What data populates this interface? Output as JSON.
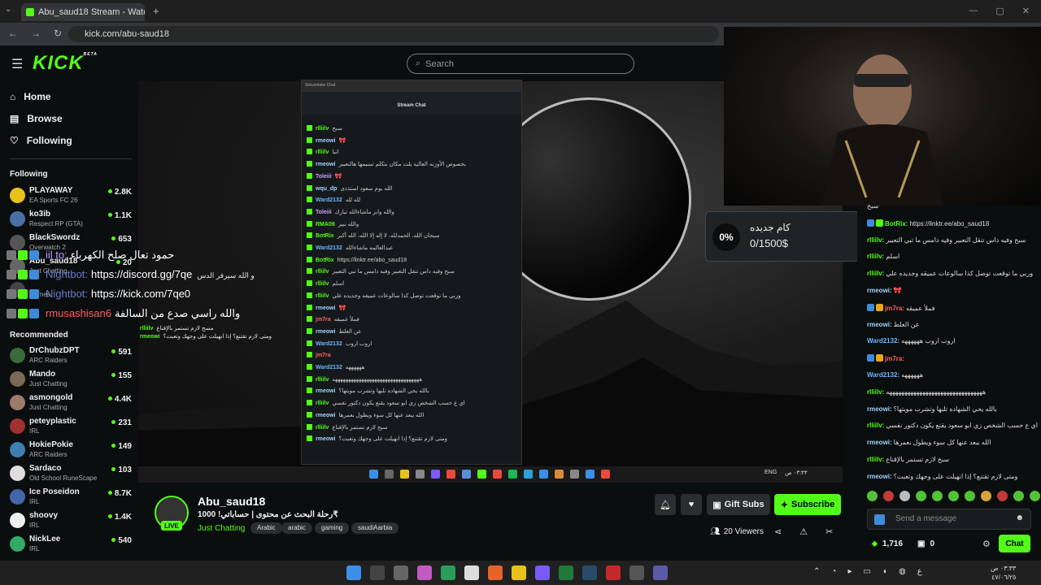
{
  "browser": {
    "tab_title": "Abu_saud18 Stream - Watch Li",
    "tab_close": "✕",
    "new_tab": "+",
    "tab_menu": "⌄",
    "url": "kick.com/abu-saud18",
    "back": "←",
    "forward": "→",
    "reload": "↻",
    "min": "—",
    "max": "▢",
    "close": "✕"
  },
  "header": {
    "logo": "KICK",
    "beta": "BETA",
    "search_placeholder": "Search"
  },
  "sidebar": {
    "nav": [
      {
        "label": "Home",
        "icon": "⌂"
      },
      {
        "label": "Browse",
        "icon": "▤"
      },
      {
        "label": "Following",
        "icon": "♡"
      }
    ],
    "following_title": "Following",
    "following": [
      {
        "name": "PLAYAWAY",
        "category": "EA Sports FC 26",
        "viewers": "2.8K",
        "color": "#e8c21a"
      },
      {
        "name": "ko3ib",
        "category": "Respect RP (GTA)",
        "viewers": "1.1K",
        "color": "#4a6fa5"
      },
      {
        "name": "BlackSwordz",
        "category": "Overwatch 2",
        "viewers": "653",
        "color": "#555"
      },
      {
        "name": "Abu_saud18",
        "category": "Just Chatting",
        "viewers": "20",
        "color": "#666"
      },
      {
        "name": "",
        "category": "Games",
        "viewers": "",
        "color": "#444"
      }
    ],
    "recommended_title": "Recommended",
    "recommended": [
      {
        "name": "DrChubzDPT",
        "category": "ARC Raiders",
        "viewers": "591",
        "color": "#3b6b3b"
      },
      {
        "name": "Mando",
        "category": "Just Chatting",
        "viewers": "155",
        "color": "#7a6a55"
      },
      {
        "name": "asmongold",
        "category": "Just Chatting",
        "viewers": "4.4K",
        "color": "#9a7b6a"
      },
      {
        "name": "peteyplastic",
        "category": "IRL",
        "viewers": "231",
        "color": "#a03030"
      },
      {
        "name": "HokiePokie",
        "category": "ARC Raiders",
        "viewers": "149",
        "color": "#3d7fb0"
      },
      {
        "name": "Sardaco",
        "category": "Old School RuneScape",
        "viewers": "103",
        "color": "#ddd"
      },
      {
        "name": "Ice Poseidon",
        "category": "IRL",
        "viewers": "8.7K",
        "color": "#4466aa"
      },
      {
        "name": "shoovy",
        "category": "IRL",
        "viewers": "1.4K",
        "color": "#eee"
      },
      {
        "name": "NickLee",
        "category": "IRL",
        "viewers": "540",
        "color": "#3a6"
      }
    ]
  },
  "video_overlay": {
    "lines": [
      {
        "user": "iil to:",
        "text": "حمود تعال صلح الكهرباء",
        "color": "#b89cff"
      },
      {
        "user": "Nightbot:",
        "text": "https://discord.gg/7qe",
        "suffix": "و الله سيرفر الدس",
        "color": "#6a78c9"
      },
      {
        "user": "Nightbot:",
        "text": "https://kick.com/7qe0",
        "suffix": "",
        "color": "#6a78c9"
      },
      {
        "user": "rmusashisan6",
        "text": "والله راسي صدع من السالفة",
        "color": "#ff6060"
      }
    ],
    "small": [
      {
        "user": "rlliilv",
        "text": "مسح لازم تستمر بالإقناع"
      },
      {
        "user": "rmeowi",
        "text": "ومتى لازم تقتنع؟ إذا انهيلت على وجهك وتعبت؟"
      }
    ]
  },
  "streamlabs": {
    "window_title": "Streamlabs Chat",
    "header": "Stream Chat",
    "messages": [
      {
        "user": "rlliilv",
        "text": "سبح",
        "color": "#53fc18"
      },
      {
        "user": "rmeowi",
        "text": "🎀",
        "color": "#9fd3ff"
      },
      {
        "user": "rlliilv",
        "text": "انبا",
        "color": "#53fc18"
      },
      {
        "user": "rmeowi",
        "text": "بخصوص الأوزنه العاليه يلت مكان بتكلم تسيمها هالتعبير",
        "color": "#9fd3ff"
      },
      {
        "user": "Toleiii",
        "text": "🎀",
        "color": "#c9a0ff"
      },
      {
        "user": "wqu_dp",
        "text": "الله يوم سعود استذذى",
        "color": "#9fd3ff"
      },
      {
        "user": "Ward2132",
        "text": "لله لله",
        "color": "#6fb3ff"
      },
      {
        "user": "Toleiii",
        "text": "والله وابر ماشاءالله تبارك",
        "color": "#c9a0ff"
      },
      {
        "user": "RMA09",
        "text": "والله نبيز",
        "color": "#53fc18"
      },
      {
        "user": "BotRix",
        "text": "سبحان الله، الحمدلله، لا إله إلا الله، الله أكبر",
        "color": "#53fc18"
      },
      {
        "user": "Ward2132",
        "text": "عبدالعالمه ماشاءالله",
        "color": "#6fb3ff"
      },
      {
        "user": "BotRix",
        "text": "https://linktr.ee/abo_saud18",
        "color": "#53fc18"
      },
      {
        "user": "rlliilv",
        "text": "سبح وفيه داس تنقل التعبير وفيه دامس ما تبي التعبير",
        "color": "#53fc18"
      },
      {
        "user": "rlliilv",
        "text": "اسلم",
        "color": "#53fc18"
      },
      {
        "user": "rlliilv",
        "text": "وربي ما توقعت توصل كذا سالوعات عميقه وجديده علي",
        "color": "#53fc18"
      },
      {
        "user": "rmeowi",
        "text": "🎀",
        "color": "#9fd3ff"
      },
      {
        "user": "jm7ra",
        "text": "فملأ عميقه",
        "color": "#ff6060"
      },
      {
        "user": "rmeowi",
        "text": "عن الغلط",
        "color": "#9fd3ff"
      },
      {
        "user": "Ward2132",
        "text": "اروب اروب",
        "color": "#6fb3ff"
      },
      {
        "user": "jm7ra",
        "text": "",
        "color": "#ff6060"
      },
      {
        "user": "Ward2132",
        "text": "ههههههه",
        "color": "#6fb3ff"
      },
      {
        "user": "rlliilv",
        "text": "هههههههههههههههههههههههههههههههههه",
        "color": "#53fc18"
      },
      {
        "user": "rmeowi",
        "text": "بالله يحي الشهاده تلبها وتشرب مويتها؟",
        "color": "#9fd3ff"
      },
      {
        "user": "rlliilv",
        "text": "اي ع حسب الشخص زي ابو سعود يقنع يكون دكتور نفسي",
        "color": "#53fc18"
      },
      {
        "user": "rmeowi",
        "text": "الله يبعد عنها كل سوء ويطول بعمرها",
        "color": "#9fd3ff"
      },
      {
        "user": "rlliilv",
        "text": "سبح لازم تستمر بالإقناع",
        "color": "#53fc18"
      },
      {
        "user": "rmeowi",
        "text": "ومتى لازم تقتنع؟ إذا انهيلت على وجهك وتعبت؟",
        "color": "#9fd3ff"
      }
    ]
  },
  "video_time": {
    "lang": "ENG",
    "time": "٠٣:٣٣ ص",
    "date": "٤٧/٠٦/٢٥"
  },
  "goal": {
    "percent": "0%",
    "title": "كام جديده",
    "value": "0/1500$"
  },
  "chat": {
    "messages": [
      {
        "user": "",
        "text": "سبح",
        "color": "#53fc18",
        "badges": []
      },
      {
        "user": "BotRix:",
        "text": "https://linktr.ee/abo_saud18",
        "color": "#53fc18",
        "badges": [
          "#3d8bd9",
          "#53fc18"
        ]
      },
      {
        "user": "rlliilv:",
        "text": "سبح وفيه داس تنقل التعبير وفيه دامس ما تبي التعبير",
        "color": "#53fc18",
        "badges": []
      },
      {
        "user": "rlliilv:",
        "text": "اسلم",
        "color": "#53fc18",
        "badges": []
      },
      {
        "user": "rlliilv:",
        "text": "وربي ما توقعت توصل كذا سالوعات عميقه وجديده علي",
        "color": "#53fc18",
        "badges": []
      },
      {
        "user": "rmeowi:",
        "text": "🎀",
        "color": "#9fd3ff",
        "badges": []
      },
      {
        "user": "jm7ra:",
        "text": "فملأ عميقه",
        "color": "#ff6060",
        "badges": [
          "#3d8bd9",
          "#e8a516"
        ]
      },
      {
        "user": "rmeowi:",
        "text": "عن الغلط",
        "color": "#9fd3ff",
        "badges": []
      },
      {
        "user": "Ward2132:",
        "text": "اروب اروب ههههههه",
        "color": "#6fb3ff",
        "badges": []
      },
      {
        "user": "jm7ra:",
        "text": "",
        "color": "#ff6060",
        "badges": [
          "#3d8bd9",
          "#e8a516"
        ]
      },
      {
        "user": "Ward2132:",
        "text": "ههههههه",
        "color": "#6fb3ff",
        "badges": []
      },
      {
        "user": "rlliilv:",
        "text": "ههههههههههههههههههههههههههههههههه",
        "color": "#53fc18",
        "badges": []
      },
      {
        "user": "rmeowi:",
        "text": "بالله يحي الشهاده تلبها وتشرب مويتها؟",
        "color": "#9fd3ff",
        "badges": []
      },
      {
        "user": "rlliilv:",
        "text": "اي ع حسب الشخص زي ابو سعود يقنع يكون دكتور نفسي",
        "color": "#53fc18",
        "badges": []
      },
      {
        "user": "rmeowi:",
        "text": "الله يبعد عنها كل سوء ويطول بعمرها",
        "color": "#9fd3ff",
        "badges": []
      },
      {
        "user": "rlliilv:",
        "text": "سبح لازم تستمر بالإقناع",
        "color": "#53fc18",
        "badges": []
      },
      {
        "user": "rmeowi:",
        "text": "ومتى لازم تقتنع؟ إذا انهيلت على وجهك وتعبت؟",
        "color": "#9fd3ff",
        "badges": []
      }
    ],
    "input_placeholder": "Send a message",
    "points": "1,716",
    "points2": "0",
    "send_label": "Chat"
  },
  "stream": {
    "name": "Abu_saud18",
    "live": "LIVE",
    "title": "رحلة البحث عن محتوى | حساباتي! 1000₹",
    "category": "Just Chatting",
    "tags": [
      "Arabic",
      "arabic",
      "gaming",
      "saudiAarbia"
    ],
    "viewers": "20 Viewers",
    "gift_label": "Gift Subs",
    "subscribe_label": "Subscribe"
  },
  "taskbar": {
    "time": "٠٣:٣٣ ص",
    "date": "٤٧/٠٦/٢٥",
    "lang": "ع"
  }
}
